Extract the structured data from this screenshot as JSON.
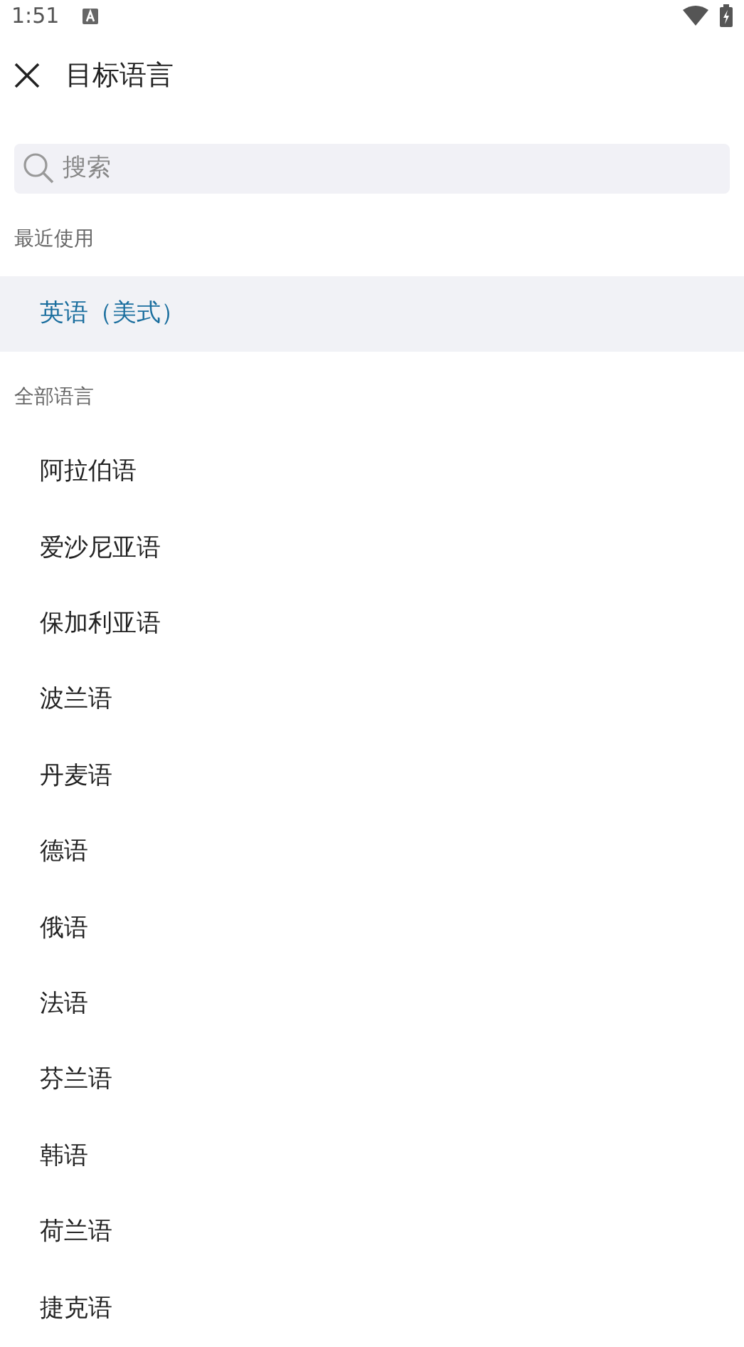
{
  "status_bar": {
    "time": "1:51"
  },
  "header": {
    "title": "目标语言"
  },
  "search": {
    "placeholder": "搜索"
  },
  "sections": [
    {
      "title": "最近使用",
      "items": [
        {
          "label": "英语（美式）",
          "selected": true
        }
      ]
    },
    {
      "title": "全部语言",
      "items": [
        {
          "label": "阿拉伯语",
          "selected": false
        },
        {
          "label": "爱沙尼亚语",
          "selected": false
        },
        {
          "label": "保加利亚语",
          "selected": false
        },
        {
          "label": "波兰语",
          "selected": false
        },
        {
          "label": "丹麦语",
          "selected": false
        },
        {
          "label": "德语",
          "selected": false
        },
        {
          "label": "俄语",
          "selected": false
        },
        {
          "label": "法语",
          "selected": false
        },
        {
          "label": "芬兰语",
          "selected": false
        },
        {
          "label": "韩语",
          "selected": false
        },
        {
          "label": "荷兰语",
          "selected": false
        },
        {
          "label": "捷克语",
          "selected": false
        }
      ]
    }
  ]
}
